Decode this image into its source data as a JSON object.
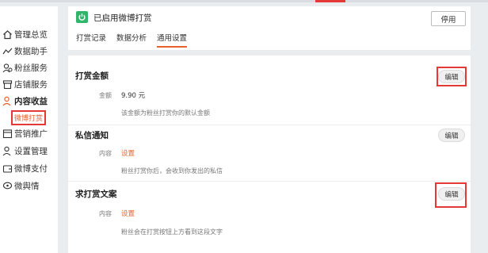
{
  "sidebar": {
    "items": [
      {
        "label": "管理总览",
        "icon": "home-icon"
      },
      {
        "label": "数据助手",
        "icon": "trend-icon"
      },
      {
        "label": "粉丝服务",
        "icon": "fans-icon"
      },
      {
        "label": "店铺服务",
        "icon": "store-icon"
      },
      {
        "label": "内容收益",
        "icon": "user-coin-icon"
      },
      {
        "label": "营销推广",
        "icon": "promo-icon"
      },
      {
        "label": "设置管理",
        "icon": "settings-user-icon"
      },
      {
        "label": "微博支付",
        "icon": "wallet-icon"
      },
      {
        "label": "微舆情",
        "icon": "opinion-icon"
      }
    ],
    "active_sub_item": "微博打赏"
  },
  "header": {
    "title": "已启用微博打赏",
    "disable_label": "停用",
    "tabs": [
      "打赏记录",
      "数据分析",
      "通用设置"
    ],
    "active_tab": "通用设置"
  },
  "sections": [
    {
      "title": "打赏金额",
      "edit_label": "编辑",
      "field_label": "金额",
      "field_value": "9.90 元",
      "hint": "该金额为粉丝打赏你的默认金额"
    },
    {
      "title": "私信通知",
      "edit_label": "编辑",
      "field_label": "内容",
      "field_value": "设置",
      "hint": "粉丝打赏你后，会收到你发出的私信"
    },
    {
      "title": "求打赏文案",
      "edit_label": "编辑",
      "field_label": "内容",
      "field_value": "设置",
      "hint": "粉丝会在打赏按钮上方看到这段文字"
    }
  ],
  "colors": {
    "accent": "#e8602c",
    "highlight": "#e53935",
    "enabled_green": "#2fb66a"
  }
}
